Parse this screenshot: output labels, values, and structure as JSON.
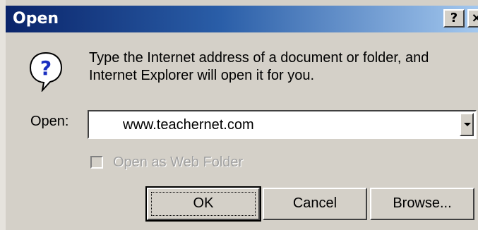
{
  "window": {
    "title": "Open",
    "help_button": "?",
    "close_button": "×"
  },
  "message": "Type the Internet address of a document or folder, and Internet Explorer will open it for you.",
  "open_field": {
    "label": "Open:",
    "value": "www.teachernet.com"
  },
  "web_folder": {
    "label": "Open as Web Folder",
    "checked": false,
    "enabled": false
  },
  "buttons": {
    "ok": "OK",
    "cancel": "Cancel",
    "browse": "Browse..."
  },
  "colors": {
    "dialog_bg": "#d4d0c8",
    "title_start": "#0a246a",
    "title_end": "#a6caf0",
    "disabled_text": "#a0a0a0"
  },
  "icons": {
    "message_icon": "question-icon",
    "dropdown": "chevron-down-icon"
  }
}
